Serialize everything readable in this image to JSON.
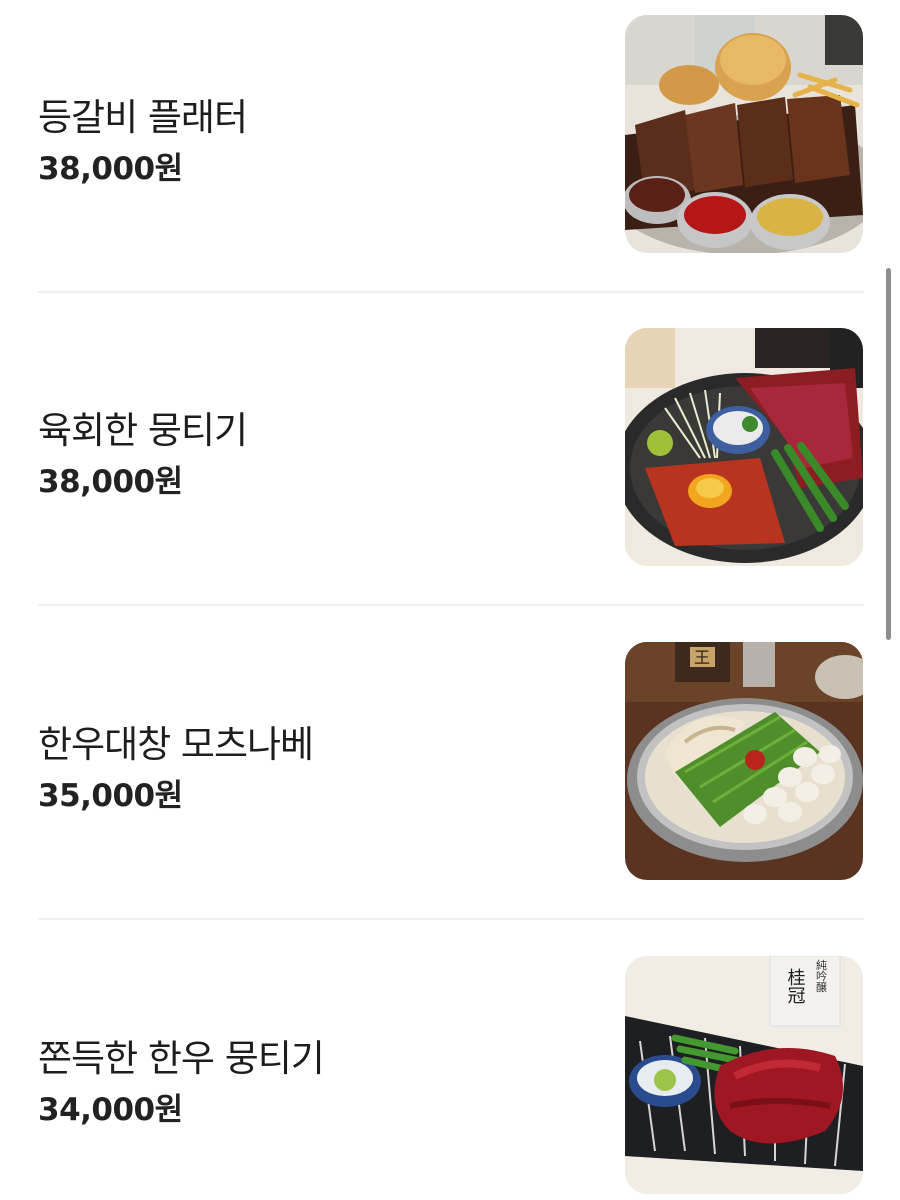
{
  "menu": {
    "items": [
      {
        "name": "등갈비 플래터",
        "price": "38,000원",
        "image": "grilled-ribs-platter-photo"
      },
      {
        "name": "육회한 뭉티기",
        "price": "38,000원",
        "image": "beef-tartare-platter-photo"
      },
      {
        "name": "한우대창 모츠나베",
        "price": "35,000원",
        "image": "motsunabe-hotpot-photo"
      },
      {
        "name": "쫀득한 한우 뭉티기",
        "price": "34,000원",
        "image": "raw-beef-slices-photo"
      }
    ]
  },
  "image_labels": {
    "sake_bottle_top": "純吟醸",
    "sake_bottle_main": "桂冠",
    "bottle_kanji": "王"
  }
}
